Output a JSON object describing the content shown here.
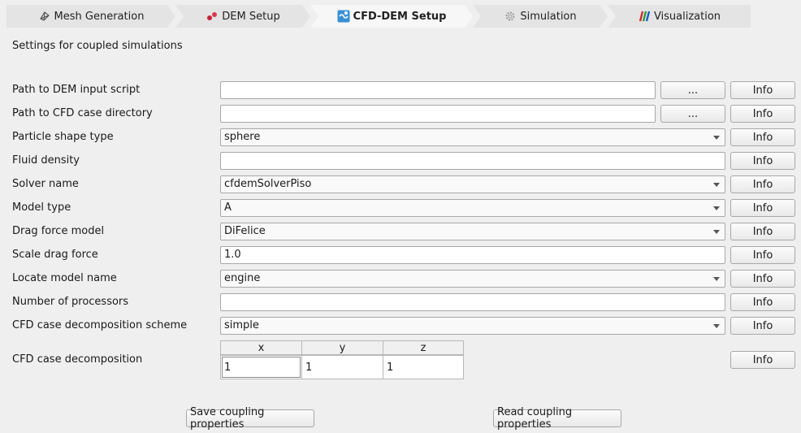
{
  "tabs": [
    {
      "label": "Mesh Generation",
      "icon": "mesh-icon",
      "active": false
    },
    {
      "label": "DEM Setup",
      "icon": "particles-icon",
      "active": false
    },
    {
      "label": "CFD-DEM Setup",
      "icon": "cfd-dem-icon",
      "active": true
    },
    {
      "label": "Simulation",
      "icon": "gear-icon",
      "active": false
    },
    {
      "label": "Visualization",
      "icon": "visualization-icon",
      "active": false
    }
  ],
  "intro": "Settings for coupled simulations",
  "rows": [
    {
      "label": "Path to DEM input script",
      "kind": "text",
      "value": "",
      "browse": "..."
    },
    {
      "label": "Path to CFD case directory",
      "kind": "text",
      "value": "",
      "browse": "..."
    },
    {
      "label": "Particle shape type",
      "kind": "combo",
      "value": "sphere"
    },
    {
      "label": "Fluid density",
      "kind": "text",
      "value": ""
    },
    {
      "label": "Solver name",
      "kind": "combo",
      "value": "cfdemSolverPiso"
    },
    {
      "label": "Model type",
      "kind": "combo",
      "value": "A"
    },
    {
      "label": "Drag force model",
      "kind": "combo",
      "value": "DiFelice"
    },
    {
      "label": "Scale drag force",
      "kind": "text",
      "value": "1.0"
    },
    {
      "label": "Locate model name",
      "kind": "combo",
      "value": "engine"
    },
    {
      "label": "Number of processors",
      "kind": "text",
      "value": ""
    },
    {
      "label": "CFD case decomposition scheme",
      "kind": "combo",
      "value": "simple"
    }
  ],
  "decomposition": {
    "label": "CFD case decomposition",
    "headers": [
      "x",
      "y",
      "z"
    ],
    "values": [
      "1",
      "1",
      "1"
    ]
  },
  "info_label": "Info",
  "buttons": {
    "save": "Save coupling properties",
    "read": "Read coupling properties"
  },
  "colors": {
    "window_bg": "#efefef",
    "tab_bg": "#e4e4e4",
    "active_tab_bg": "#f7f7f7",
    "field_bg": "#ffffff",
    "border": "#a8a8a8"
  }
}
